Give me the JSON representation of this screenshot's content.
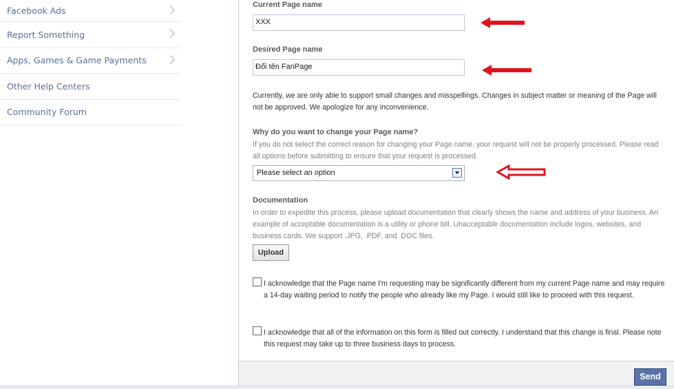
{
  "sidebar": {
    "items": [
      {
        "label": "Facebook Ads",
        "has_chevron": true
      },
      {
        "label": "Report Something",
        "has_chevron": true
      },
      {
        "label": "Apps, Games & Game Payments",
        "has_chevron": true
      },
      {
        "label": "Other Help Centers",
        "has_chevron": false
      },
      {
        "label": "Community Forum",
        "has_chevron": false
      }
    ]
  },
  "form": {
    "current_name": {
      "label": "Current Page name",
      "value": "XXX"
    },
    "desired_name": {
      "label": "Desired Page name",
      "value": "Đổi tên FanPage"
    },
    "notice": "Currently, we are only able to support small changes and misspellings. Changes in subject matter or meaning of the Page will not be approved. We apologize for any inconvenience.",
    "reason": {
      "label": "Why do you want to change your Page name?",
      "help": "If you do not select the correct reason for changing your Page name, your request will not be properly processed. Please read all options before submitting to ensure that your request is processed.",
      "selected": "Please select an option"
    },
    "documentation": {
      "label": "Documentation",
      "help": "In order to expedite this process, please upload documentation that clearly shows the name and address of your business. An example of acceptable documentation is a utility or phone bill. Unacceptable documentation include logos, websites, and business cards. We support .JPG, .PDF, and .DOC files.",
      "upload_label": "Upload"
    },
    "ack1": {
      "text": "I acknowledge that the Page name I'm requesting may be significantly different from my current Page name and may require a 14-day waiting period to notify the people who already like my Page. I would still like to proceed with this request.",
      "checked": false
    },
    "ack2": {
      "text": "I acknowledge that all of the information on this form is filled out correctly. I understand that this change is final. Please note this request may take up to three business days to process.",
      "checked": false
    },
    "send_label": "Send"
  },
  "annotations": {
    "arrow_color": "#e0141e",
    "arrow_count": 3
  },
  "colors": {
    "link": "#5b6f94",
    "button_blue": "#5b74a8"
  }
}
